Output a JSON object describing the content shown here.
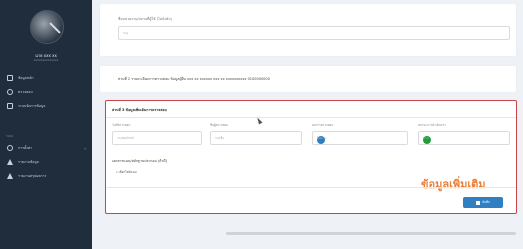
{
  "sidebar": {
    "user_name": "นาย xxx xx",
    "user_sub": "xxxxxxxxxxxxxx",
    "items": [
      {
        "label": "ข้อมูลหลัก"
      },
      {
        "label": "ตรวจสอบ"
      },
      {
        "label": "ระบบจัดการข้อมูล"
      }
    ],
    "section": "ระบบ",
    "sub_items": [
      {
        "label": "การตั้งค่า"
      },
      {
        "label": "รายงานข้อมูล"
      },
      {
        "label": "รายงานสรุปผลการ"
      }
    ]
  },
  "top_card": {
    "label": "ชื่อหน่วยงาน/สถานที่ผู้ใช้ (ไม่บังคับ)",
    "input_placeholder": "ระบุ"
  },
  "section2": {
    "text": "ส่วนที่ 2 รายละเอียดการตรวจสอบ ข้อมูลผู้ยื่น xxx xx xxxxxx xxx xx xxxxxxxxxx 0100000000"
  },
  "section3": {
    "title": "ส่วนที่ 3 ข้อมูลเพิ่มเติมการตรวจสอบ",
    "fields": [
      {
        "label": "วันที่ตรวจสอบ",
        "placeholder": "วว/ดด/ปปปป"
      },
      {
        "label": "ชื่อผู้ตรวจสอบ",
        "placeholder": "ระบุชื่อ"
      },
      {
        "label": "ผลการตรวจสอบ",
        "value": "ไม่ผ่าน",
        "dot_color": "#2f7fc1"
      },
      {
        "label": "สถานะการดำเนินการ",
        "value": "ผ่าน",
        "dot_color": "#1e9e3a"
      }
    ],
    "upload_label": "เอกสารแนบ/หลักฐานประกอบ (ถ้ามี)",
    "upload_link": "เลือกไฟล์แนบ",
    "annotation": "ข้อมูลเพิ่มเติม",
    "save_label": "บันทึก"
  },
  "colors": {
    "accent": "#2f7fc1",
    "highlight_border": "#c9464a",
    "annotation": "#e8823a"
  }
}
